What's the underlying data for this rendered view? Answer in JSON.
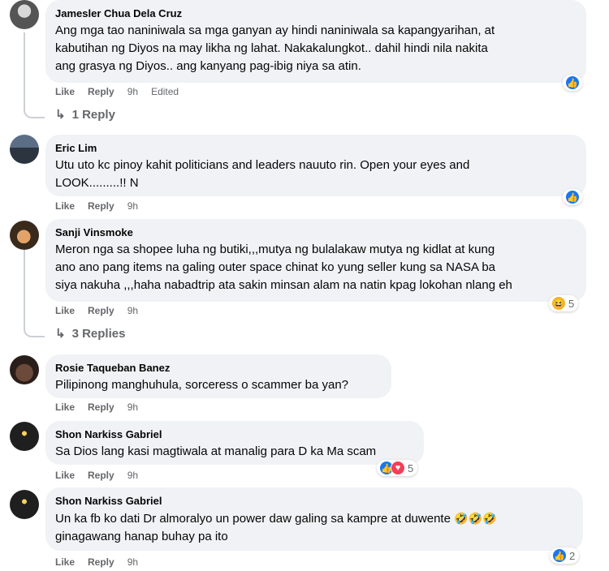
{
  "comments": [
    {
      "author": "Jamesler Chua Dela Cruz",
      "lines": [
        "Ang mga tao naniniwala sa mga ganyan ay hindi naniniwala sa kapangyarihan, at",
        "kabutihan ng Diyos na may likha ng lahat. Nakakalungkot.. dahil hindi nila nakita",
        "ang grasya ng Diyos.. ang kanyang pag-ibig niya sa atin."
      ],
      "like": "Like",
      "reply": "Reply",
      "time": "9h",
      "edited": "Edited",
      "replies": "1 Reply"
    },
    {
      "author": "Eric Lim",
      "lines": [
        "Utu uto kc pinoy kahit politicians and leaders nauuto rin. Open your eyes and",
        "LOOK.........!! N"
      ],
      "like": "Like",
      "reply": "Reply",
      "time": "9h"
    },
    {
      "author": "Sanji Vinsmoke",
      "lines": [
        "Meron nga sa shopee luha ng butiki,,,mutya ng bulalakaw mutya ng kidlat at kung",
        "ano ano pang items na galing outer space chinat ko yung seller kung sa NASA ba",
        "siya nakuha ,,,haha nabadtrip ata sakin minsan alam na natin kpag lokohan nlang eh"
      ],
      "like": "Like",
      "reply": "Reply",
      "time": "9h",
      "reaction_count": "5",
      "replies": "3 Replies"
    },
    {
      "author": "Rosie Taqueban Banez",
      "lines": [
        "Pilipinong manghuhula, sorceress o scammer ba yan?"
      ],
      "like": "Like",
      "reply": "Reply",
      "time": "9h"
    },
    {
      "author": "Shon Narkiss Gabriel",
      "lines": [
        "Sa Dios lang kasi magtiwala at manalig para D ka Ma scam"
      ],
      "like": "Like",
      "reply": "Reply",
      "time": "9h",
      "reaction_count": "5"
    },
    {
      "author": "Shon Narkiss Gabriel",
      "lines": [
        "Un ka fb ko dati Dr almoralyo un power daw galing sa kampre at duwente",
        "ginagawang hanap buhay pa ito"
      ],
      "like": "Like",
      "reply": "Reply",
      "time": "9h",
      "reaction_count": "2"
    }
  ],
  "icons": {
    "like": "like-icon",
    "heart": "heart-icon",
    "haha": "haha-icon",
    "reply_arrow": "reply-arrow-icon"
  }
}
